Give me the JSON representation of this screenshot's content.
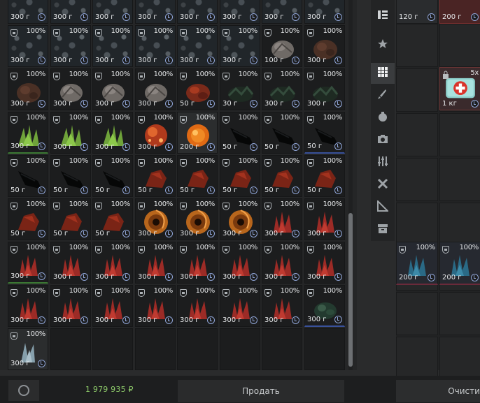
{
  "inventory": {
    "rows": [
      [
        {
          "w": "300 г",
          "pct": null,
          "art": "stones"
        },
        {
          "w": "300 г",
          "pct": null,
          "art": "stones"
        },
        {
          "w": "300 г",
          "pct": null,
          "art": "stones"
        },
        {
          "w": "300 г",
          "pct": null,
          "art": "stones"
        },
        {
          "w": "300 г",
          "pct": null,
          "art": "stones"
        },
        {
          "w": "300 г",
          "pct": null,
          "art": "stones"
        },
        {
          "w": "300 г",
          "pct": null,
          "art": "stones"
        },
        {
          "w": "300 г",
          "pct": null,
          "art": "stones"
        }
      ],
      [
        {
          "w": "300 г",
          "pct": "100%",
          "art": "stones"
        },
        {
          "w": "300 г",
          "pct": "100%",
          "art": "stones"
        },
        {
          "w": "300 г",
          "pct": "100%",
          "art": "stones"
        },
        {
          "w": "300 г",
          "pct": "100%",
          "art": "stones"
        },
        {
          "w": "300 г",
          "pct": "100%",
          "art": "stones"
        },
        {
          "w": "300 г",
          "pct": "100%",
          "art": "stones"
        },
        {
          "w": "100 г",
          "pct": "100%",
          "art": "greyrock"
        },
        {
          "w": "300 г",
          "pct": "100%",
          "art": "brownrock"
        }
      ],
      [
        {
          "w": "300 г",
          "pct": "100%",
          "art": "brownrock"
        },
        {
          "w": "300 г",
          "pct": "100%",
          "art": "greyrock"
        },
        {
          "w": "300 г",
          "pct": "100%",
          "art": "greyrock"
        },
        {
          "w": "300 г",
          "pct": "100%",
          "art": "greyrock"
        },
        {
          "w": "50 г",
          "pct": "100%",
          "art": "redclump"
        },
        {
          "w": "30 г",
          "pct": "100%",
          "art": "darkmoss"
        },
        {
          "w": "300 г",
          "pct": "100%",
          "art": "darkmoss"
        },
        {
          "w": "300 г",
          "pct": "100%",
          "art": "darkmoss"
        }
      ],
      [
        {
          "w": "300 г",
          "pct": "100%",
          "art": "greenspike",
          "b": "green"
        },
        {
          "w": "300 г",
          "pct": "100%",
          "art": "greenspike"
        },
        {
          "w": "300 г",
          "pct": "100%",
          "art": "greenspike"
        },
        {
          "w": "300 г",
          "pct": "100%",
          "art": "redorb"
        },
        {
          "w": "200 г",
          "pct": "100%",
          "art": "orangeorb",
          "bright": true
        },
        {
          "w": "50 г",
          "pct": "100%",
          "art": "blackshard"
        },
        {
          "w": "50 г",
          "pct": "100%",
          "art": "blackshard"
        },
        {
          "w": "50 г",
          "pct": "100%",
          "art": "blackshard",
          "b": "blue"
        }
      ],
      [
        {
          "w": "50 г",
          "pct": "100%",
          "art": "blackshard"
        },
        {
          "w": "50 г",
          "pct": "100%",
          "art": "blackshard"
        },
        {
          "w": "50 г",
          "pct": "100%",
          "art": "blackshard"
        },
        {
          "w": "50 г",
          "pct": "100%",
          "art": "redchunk"
        },
        {
          "w": "50 г",
          "pct": "100%",
          "art": "redchunk"
        },
        {
          "w": "50 г",
          "pct": "100%",
          "art": "redchunk"
        },
        {
          "w": "50 г",
          "pct": "100%",
          "art": "redchunk"
        },
        {
          "w": "50 г",
          "pct": "100%",
          "art": "redchunk"
        }
      ],
      [
        {
          "w": "50 г",
          "pct": "100%",
          "art": "redchunk"
        },
        {
          "w": "50 г",
          "pct": "100%",
          "art": "redchunk"
        },
        {
          "w": "50 г",
          "pct": "100%",
          "art": "redchunk"
        },
        {
          "w": "300 г",
          "pct": "100%",
          "art": "swirl"
        },
        {
          "w": "300 г",
          "pct": "100%",
          "art": "swirl"
        },
        {
          "w": "300 г",
          "pct": "100%",
          "art": "swirl"
        },
        {
          "w": "300 г",
          "pct": "100%",
          "art": "redcoral"
        },
        {
          "w": "300 г",
          "pct": "100%",
          "art": "redcoral"
        }
      ],
      [
        {
          "w": "300 г",
          "pct": "100%",
          "art": "redcoral",
          "b": "green"
        },
        {
          "w": "300 г",
          "pct": "100%",
          "art": "redcoral"
        },
        {
          "w": "300 г",
          "pct": "100%",
          "art": "redcoral"
        },
        {
          "w": "300 г",
          "pct": "100%",
          "art": "redcoral"
        },
        {
          "w": "300 г",
          "pct": "100%",
          "art": "redcoral"
        },
        {
          "w": "300 г",
          "pct": "100%",
          "art": "redcoral"
        },
        {
          "w": "300 г",
          "pct": "100%",
          "art": "redcoral"
        },
        {
          "w": "300 г",
          "pct": "100%",
          "art": "redcoral"
        }
      ],
      [
        {
          "w": "300 г",
          "pct": "100%",
          "art": "redcoral"
        },
        {
          "w": "300 г",
          "pct": "100%",
          "art": "redcoral"
        },
        {
          "w": "300 г",
          "pct": "100%",
          "art": "redcoral"
        },
        {
          "w": "300 г",
          "pct": "100%",
          "art": "redcoral"
        },
        {
          "w": "300 г",
          "pct": "100%",
          "art": "redcoral"
        },
        {
          "w": "300 г",
          "pct": "100%",
          "art": "redcoral"
        },
        {
          "w": "300 г",
          "pct": "100%",
          "art": "redcoral"
        },
        {
          "w": "300 г",
          "pct": "100%",
          "art": "darkgreenclump",
          "b": "blue"
        }
      ],
      [
        {
          "w": "300 г",
          "pct": "100%",
          "art": "paleshard",
          "bright": true
        },
        {
          "empty": true
        },
        {
          "empty": true
        },
        {
          "empty": true
        },
        {
          "empty": true
        },
        {
          "empty": true
        },
        {
          "empty": true
        },
        {
          "empty": true
        }
      ]
    ]
  },
  "categories": [
    {
      "icon": "list-icon"
    },
    {
      "icon": "star-icon"
    },
    {
      "icon": "grid-icon",
      "active": true
    },
    {
      "icon": "knife-icon"
    },
    {
      "icon": "grenade-icon"
    },
    {
      "icon": "camera-icon"
    },
    {
      "icon": "sliders-icon"
    },
    {
      "icon": "tools-icon"
    },
    {
      "icon": "ruler-icon"
    },
    {
      "icon": "archive-icon"
    }
  ],
  "stash": {
    "top_items": [
      {
        "w": "120 г"
      },
      {
        "w": "200 г"
      }
    ],
    "medkit": {
      "count": "5x",
      "w": "1 кг"
    },
    "bottom_items": [
      {
        "w": "200 г",
        "pct": "100%"
      },
      {
        "w": "200 г",
        "pct": "100%"
      }
    ]
  },
  "footer": {
    "money": "1 979 935 ₽",
    "sell_label": "Продать",
    "clear_label": "Очистить"
  },
  "colors": {
    "money": "#8ecb6a",
    "clock": "#8fa4d6",
    "accent_red": "#c0392b"
  }
}
